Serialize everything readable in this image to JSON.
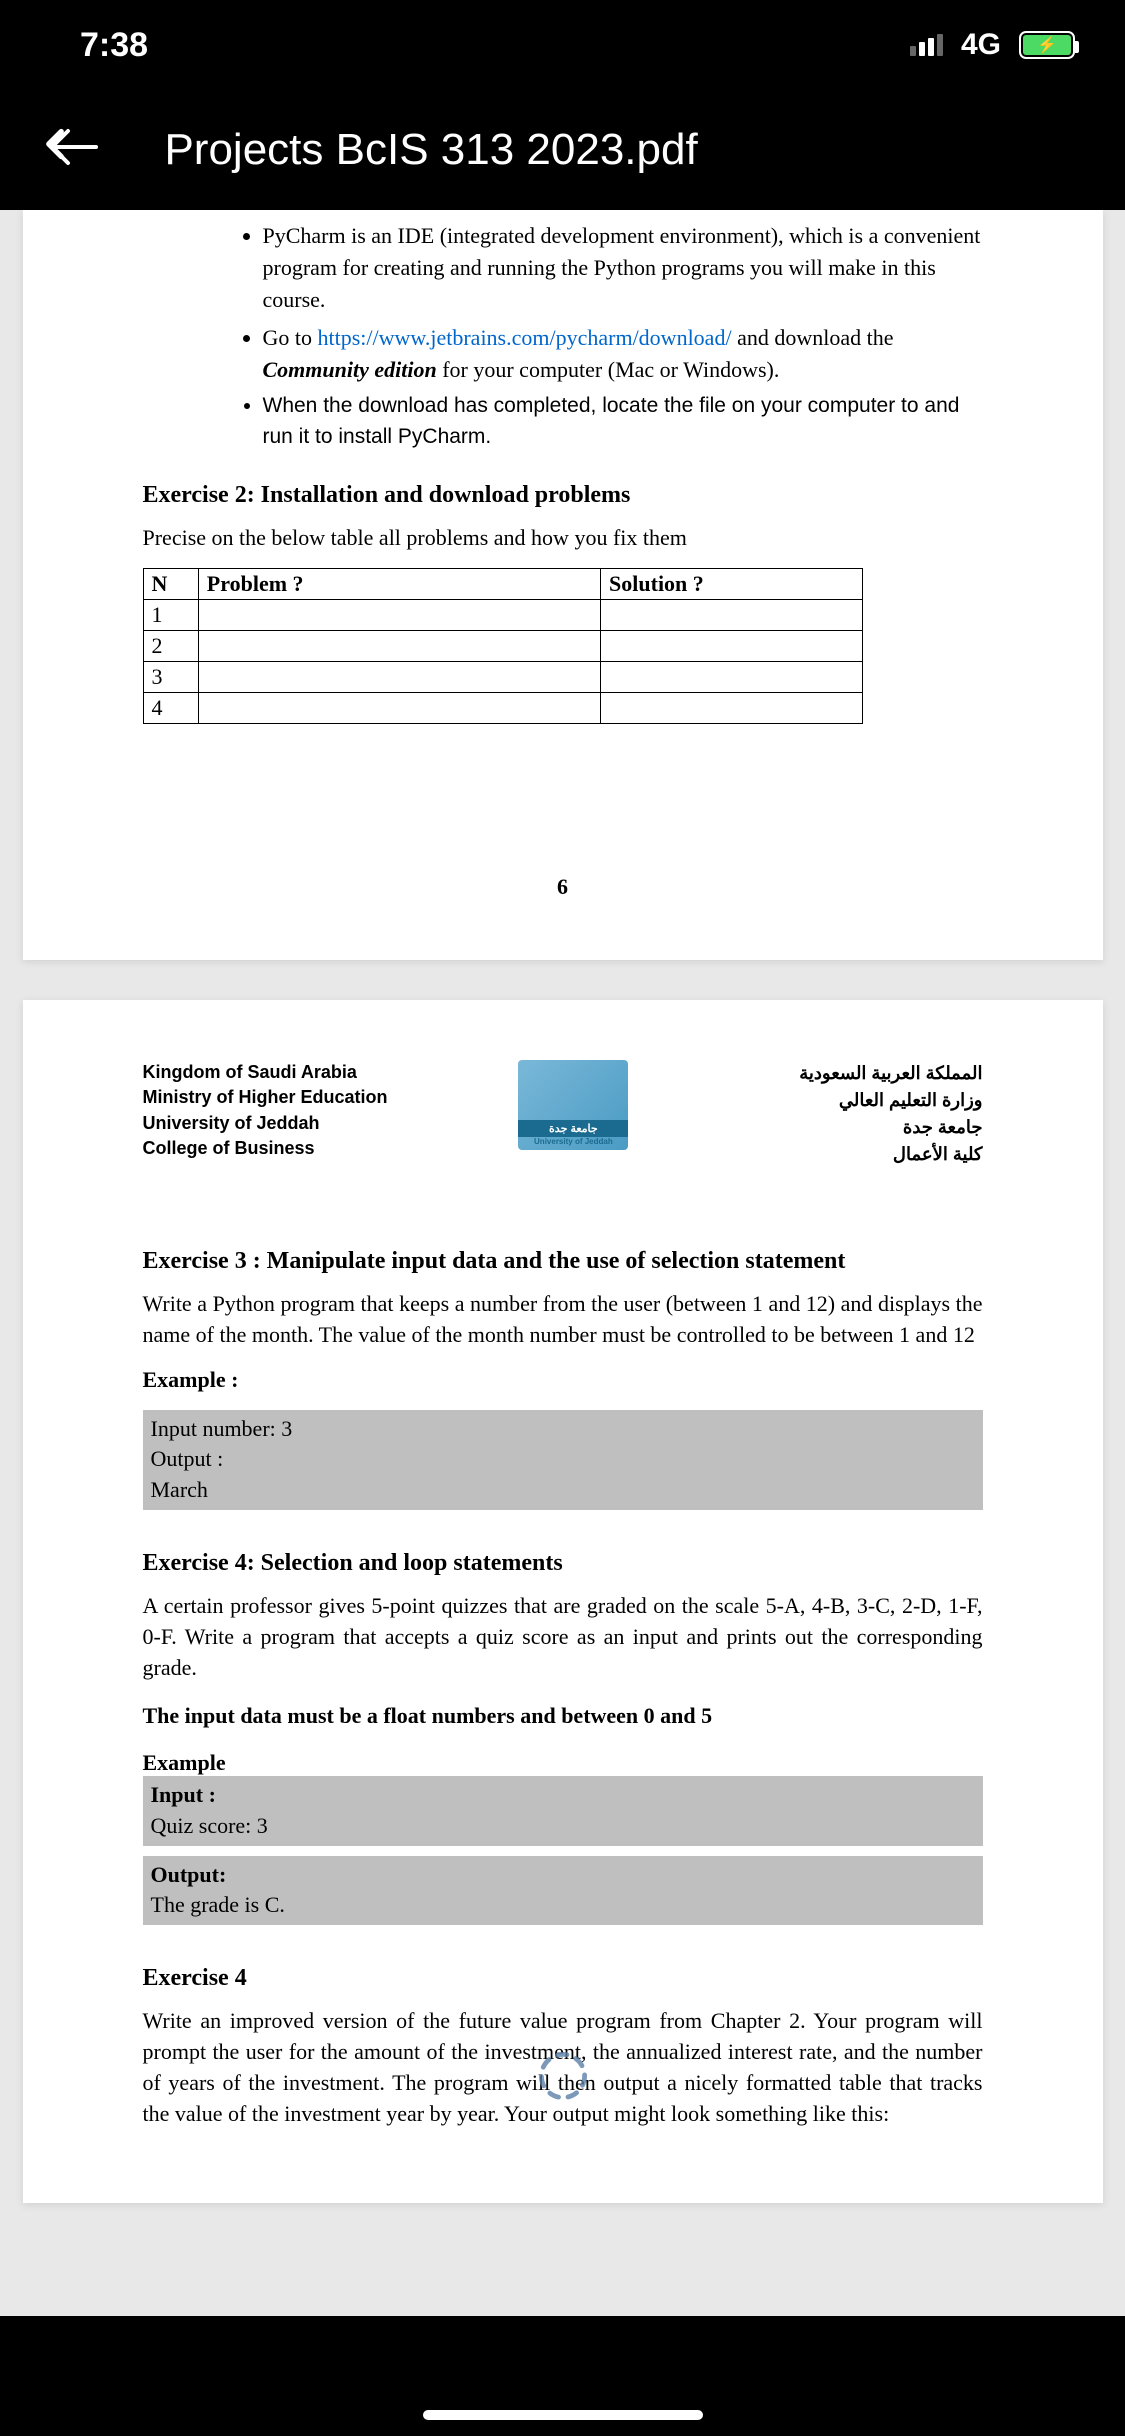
{
  "status": {
    "time": "7:38",
    "network": "4G"
  },
  "header": {
    "title": "Projects BcIS 313 2023.pdf"
  },
  "page1": {
    "bullets": {
      "b1a": "PyCharm is an IDE (integrated development environment), which is a convenient program for creating and running the Python programs you will make in this course.",
      "b2a": "Go to ",
      "b2link": "https://www.jetbrains.com/pycharm/download/",
      "b2b": " and download the ",
      "b2c": "Community edition",
      "b2d": " for your computer (Mac or Windows).",
      "b3a": "When the download has completed, locate the file on your computer to and run it to install PyCharm."
    },
    "ex2_heading": "Exercise 2: Installation and download problems",
    "ex2_text": "Precise on the below table all problems and how you fix them",
    "table": {
      "h_n": "N",
      "h_problem": "Problem ?",
      "h_solution": "Solution ?",
      "rows": [
        "1",
        "2",
        "3",
        "4"
      ]
    },
    "page_number": "6"
  },
  "page2": {
    "letterhead": {
      "left": {
        "l1": "Kingdom of Saudi Arabia",
        "l2": "Ministry of Higher Education",
        "l3": "University of Jeddah",
        "l4": "College of Business"
      },
      "logo_ar": "جامعة جدة",
      "logo_en": "University of Jeddah",
      "right": {
        "r1": "المملكة العربية السعودية",
        "r2": "وزارة التعليم العالي",
        "r3": "جامعة جدة",
        "r4": "كلية الأعمال"
      }
    },
    "ex3_heading": "Exercise 3 : Manipulate input data and the use of selection statement",
    "ex3_text": "Write a Python program that keeps a number from the user (between 1 and 12) and displays the name of the month. The value of the month number must be controlled to be between 1 and 12",
    "example_label": "Example :",
    "ex3_box": {
      "l1": "Input number: 3",
      "l2": "Output :",
      "l3": "March"
    },
    "ex4_heading": "Exercise 4: Selection and loop statements",
    "ex4_text": "A certain  professor gives 5-point quizzes that are graded on the scale 5-A, 4-B, 3-C, 2-D, 1-F, 0-F. Write a program that accepts a quiz score as an input and prints out the corresponding grade.",
    "ex4_bold": "The input data must be a float numbers and between 0 and 5",
    "ex4_example_label": "Example",
    "ex4_box1": {
      "l1": "Input :",
      "l2": "Quiz score: 3"
    },
    "ex4_box2": {
      "l1": "Output:",
      "l2": "The grade is C."
    },
    "ex4b_heading": "Exercise 4",
    "ex4b_text": "Write an improved version of the future value program from Chapter 2. Your program will prompt the user for the amount of the investment, the annualized interest rate, and the number of years of the investment. The program will then output a nicely formatted table that tracks the value of the investment year by year. Your output might look something like this:"
  }
}
